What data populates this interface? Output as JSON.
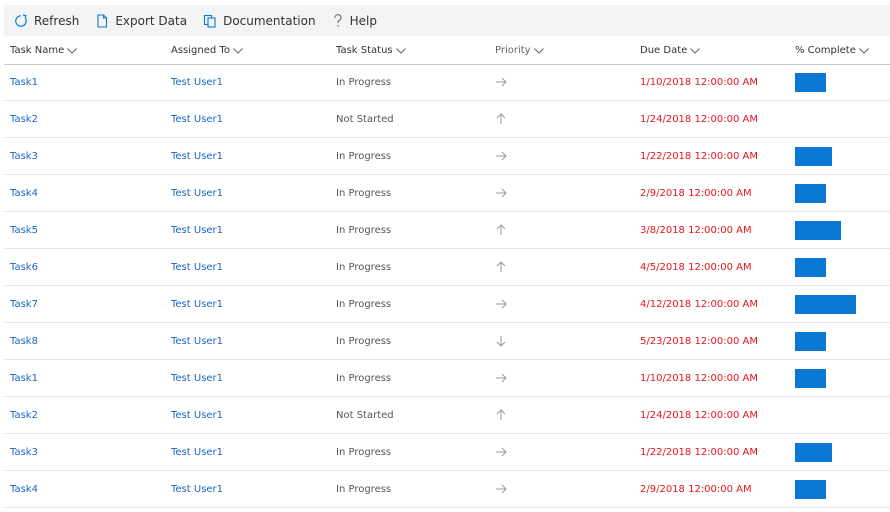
{
  "toolbar": {
    "refresh": "Refresh",
    "export": "Export Data",
    "documentation": "Documentation",
    "help": "Help"
  },
  "columns": {
    "task_name": "Task Name",
    "assigned_to": "Assigned To",
    "task_status": "Task Status",
    "priority": "Priority",
    "due_date": "Due Date",
    "pct_complete": "% Complete"
  },
  "colors": {
    "accent": "#0a78d4",
    "link": "#1a66c2",
    "due": "#e8141d"
  },
  "rows": [
    {
      "name": "Task1",
      "user": "Test User1",
      "status": "In Progress",
      "priority": "right-arrow-icon",
      "due": "1/10/2018 12:00:00 AM",
      "pct": 0.5
    },
    {
      "name": "Task2",
      "user": "Test User1",
      "status": "Not Started",
      "priority": "up-arrow-icon",
      "due": "1/24/2018 12:00:00 AM",
      "pct": 0
    },
    {
      "name": "Task3",
      "user": "Test User1",
      "status": "In Progress",
      "priority": "right-arrow-icon",
      "due": "1/22/2018 12:00:00 AM",
      "pct": 0.6
    },
    {
      "name": "Task4",
      "user": "Test User1",
      "status": "In Progress",
      "priority": "right-arrow-icon",
      "due": "2/9/2018 12:00:00 AM",
      "pct": 0.5
    },
    {
      "name": "Task5",
      "user": "Test User1",
      "status": "In Progress",
      "priority": "up-arrow-icon",
      "due": "3/8/2018 12:00:00 AM",
      "pct": 0.75
    },
    {
      "name": "Task6",
      "user": "Test User1",
      "status": "In Progress",
      "priority": "up-arrow-icon",
      "due": "4/5/2018 12:00:00 AM",
      "pct": 0.5
    },
    {
      "name": "Task7",
      "user": "Test User1",
      "status": "In Progress",
      "priority": "right-arrow-icon",
      "due": "4/12/2018 12:00:00 AM",
      "pct": 1.0
    },
    {
      "name": "Task8",
      "user": "Test User1",
      "status": "In Progress",
      "priority": "down-arrow-icon",
      "due": "5/23/2018 12:00:00 AM",
      "pct": 0.5
    },
    {
      "name": "Task1",
      "user": "Test User1",
      "status": "In Progress",
      "priority": "right-arrow-icon",
      "due": "1/10/2018 12:00:00 AM",
      "pct": 0.5
    },
    {
      "name": "Task2",
      "user": "Test User1",
      "status": "Not Started",
      "priority": "up-arrow-icon",
      "due": "1/24/2018 12:00:00 AM",
      "pct": 0
    },
    {
      "name": "Task3",
      "user": "Test User1",
      "status": "In Progress",
      "priority": "right-arrow-icon",
      "due": "1/22/2018 12:00:00 AM",
      "pct": 0.6
    },
    {
      "name": "Task4",
      "user": "Test User1",
      "status": "In Progress",
      "priority": "right-arrow-icon",
      "due": "2/9/2018 12:00:00 AM",
      "pct": 0.5
    }
  ]
}
